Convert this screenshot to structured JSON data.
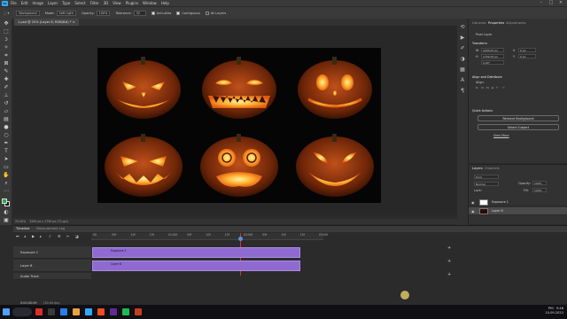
{
  "menu": {
    "items": [
      "File",
      "Edit",
      "Image",
      "Layer",
      "Type",
      "Select",
      "Filter",
      "3D",
      "View",
      "Plugins",
      "Window",
      "Help"
    ]
  },
  "options": {
    "mode_label": "Background",
    "mode_field": "Background",
    "mode2_label": "Mode:",
    "mode2_value": "Soft Light",
    "opacity_label": "Opacity:",
    "opacity_value": "100%",
    "tolerance_label": "Tolerance:",
    "tolerance_value": "32",
    "antialias_label": "Anti-alias",
    "contiguous_label": "Contiguous",
    "all_layers_label": "All Layers"
  },
  "document": {
    "tab_title": "1.psd @ 25% (Layer 8, RGB/8#) *",
    "zoom": "25.00%",
    "doc_size": "3200 px x 1750 px (72 ppi)"
  },
  "properties": {
    "tabs": [
      "Libraries",
      "Properties",
      "Adjustments"
    ],
    "active_tab": 1,
    "layer_type": "Pixel Layer",
    "transform_label": "Transform",
    "w_value": "3200.67 px",
    "h_value": "1750.07 px",
    "x_value": "0 px",
    "y_value": "0 px",
    "angle_value": "0.00°",
    "align_label": "Align and Distribute",
    "align_sub": "Align:",
    "quick_actions_label": "Quick Actions",
    "remove_bg_button": "Remove Background",
    "select_subject_button": "Select Subject",
    "view_more_link": "View More"
  },
  "layers": {
    "tabs": [
      "Layers",
      "Channels"
    ],
    "kind_label": "Kind",
    "blend_value": "Normal",
    "opacity_label": "Opacity:",
    "opacity_value": "100%",
    "lock_label": "Lock:",
    "fill_label": "Fill:",
    "fill_value": "100%",
    "items": [
      {
        "name": "Exposure 1",
        "selected": false
      },
      {
        "name": "Layer 8",
        "selected": true
      }
    ]
  },
  "timeline": {
    "tabs": [
      "Timeline",
      "Measurement Log"
    ],
    "ruler_labels": [
      "00",
      "05f",
      "10f",
      "15f",
      "01:00f",
      "05f",
      "10f",
      "15f",
      "02:00f",
      "05f",
      "10f",
      "15f",
      "03:00f"
    ],
    "tracks": [
      {
        "label": "Exposure 1",
        "clip": "Exposure 1"
      },
      {
        "label": "Layer 8",
        "clip": "Layer 8"
      },
      {
        "label": "Audio Track",
        "clip": ""
      }
    ],
    "timecode": "0:00:00:09",
    "fps": "(30.00 fps)"
  },
  "taskbar": {
    "time": "9:46",
    "date": "10.09.2022",
    "lang": "РУС"
  },
  "colors": {
    "accent": "#31a8ff",
    "clip": "#8f6ad0",
    "playhead": "#e03030",
    "pumpkin_glow": "#ffb030"
  },
  "icons": [
    "move-icon",
    "marquee-icon",
    "lasso-icon",
    "magic-wand-icon",
    "crop-icon",
    "eyedropper-icon",
    "healing-icon",
    "brush-icon",
    "stamp-icon",
    "history-brush-icon",
    "eraser-icon",
    "gradient-icon",
    "blur-icon",
    "dodge-icon",
    "pen-icon",
    "type-icon",
    "path-select-icon",
    "rectangle-icon",
    "hand-icon",
    "zoom-icon"
  ]
}
